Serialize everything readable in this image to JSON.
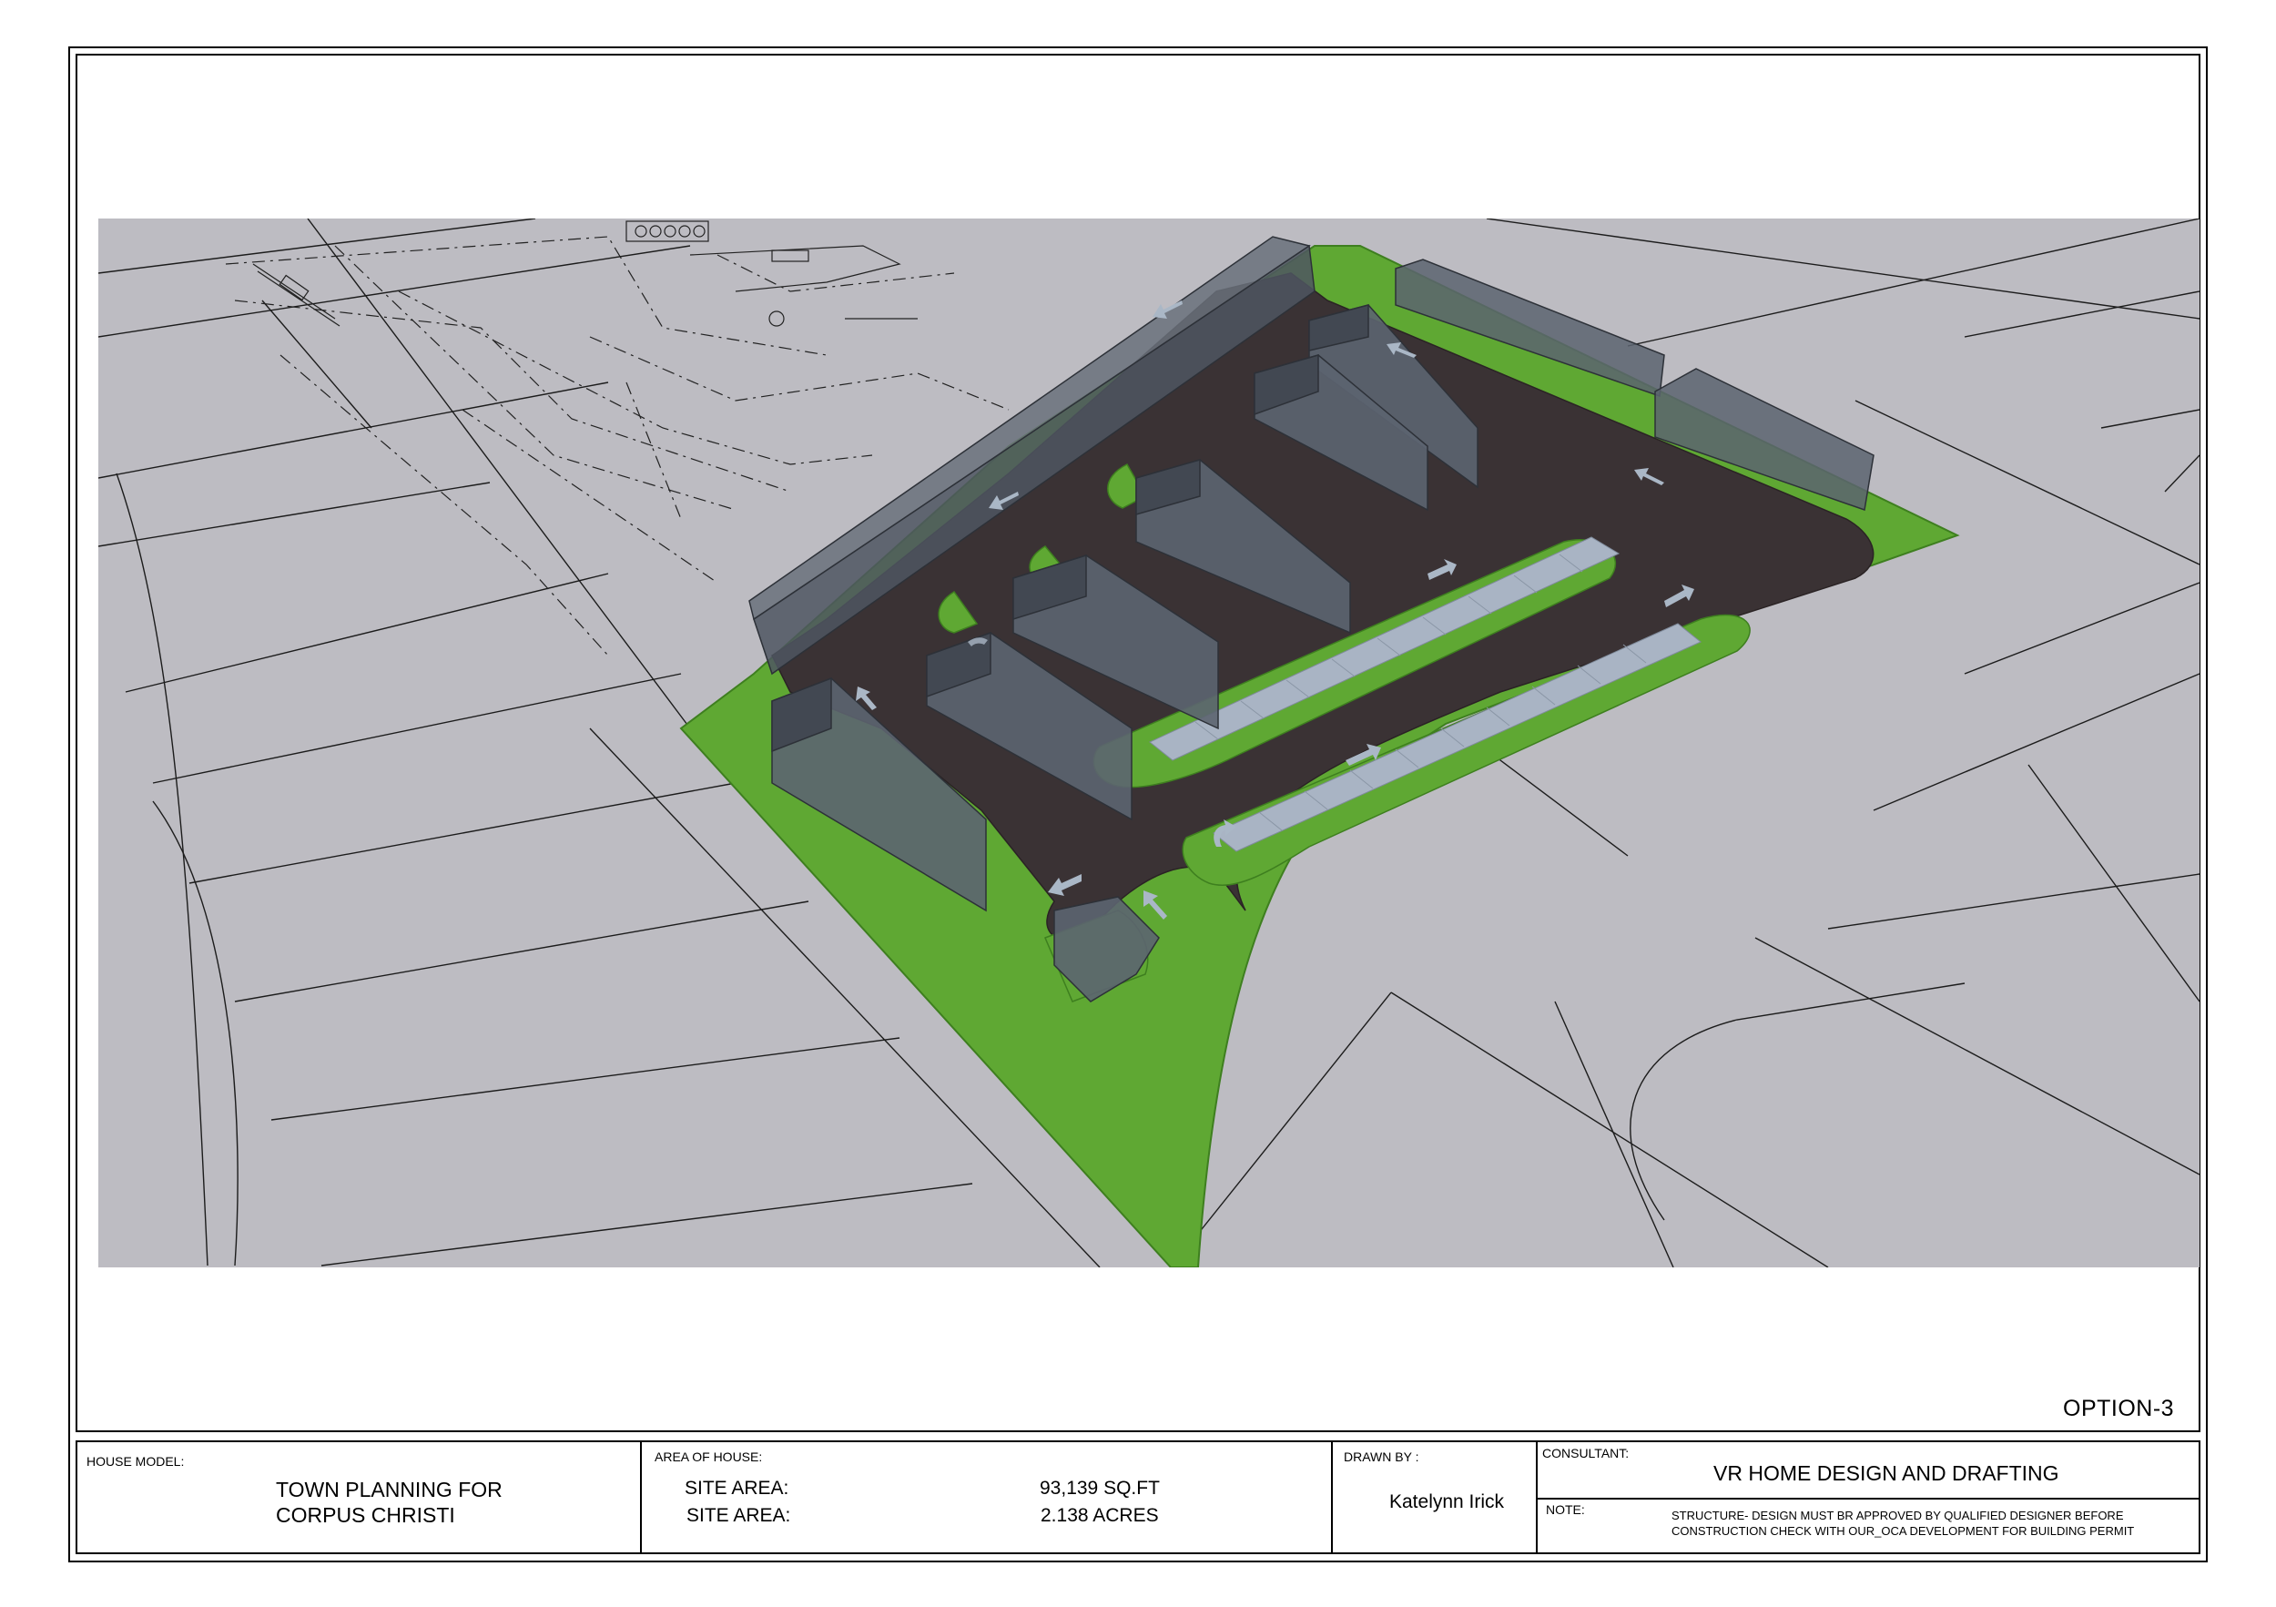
{
  "sheet": {
    "option_label": "OPTION-3"
  },
  "title_block": {
    "house_model_label": "HOUSE MODEL:",
    "project_title_line1": "TOWN PLANNING FOR",
    "project_title_line2": "CORPUS CHRISTI",
    "area_label": "AREA OF HOUSE:",
    "site_area_label_1": "SITE AREA:",
    "site_area_value_1": "93,139 SQ.FT",
    "site_area_label_2": "SITE AREA:",
    "site_area_value_2": "2.138 ACRES",
    "drawn_by_label": "DRAWN BY :",
    "drawn_by_name": "Katelynn Irick",
    "consultant_label": "CONSULTANT:",
    "consultant_name": "VR HOME DESIGN AND DRAFTING",
    "note_label": "NOTE:",
    "note_line1": "STRUCTURE- DESIGN MUST BR APPROVED BY QUALIFIED DESIGNER  BEFORE",
    "note_line2": "CONSTRUCTION CHECK WITH OUR_OCA  DEVELOPMENT FOR BUILDING PERMIT"
  },
  "colors": {
    "ground": "#bdbcc2",
    "grass": "#5fa833",
    "pavement": "#3a3234",
    "building": "#5c6470",
    "parking": "#a9b4c4",
    "arrow": "#aab7c6"
  }
}
